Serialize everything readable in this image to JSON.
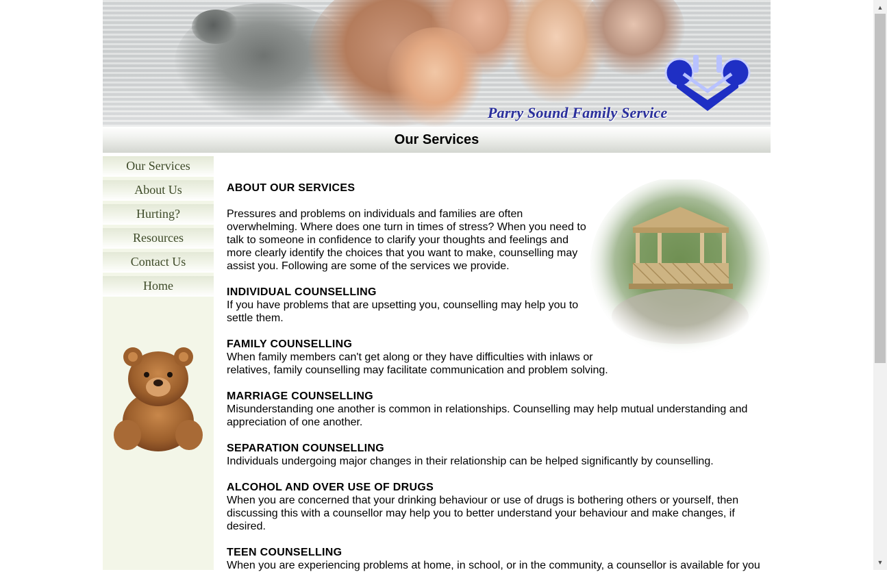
{
  "header": {
    "brand": "Parry Sound Family Service",
    "page_title": "Our Services"
  },
  "sidebar": {
    "items": [
      {
        "label": "Our Services"
      },
      {
        "label": "About Us"
      },
      {
        "label": "Hurting?"
      },
      {
        "label": "Resources"
      },
      {
        "label": "Contact Us"
      },
      {
        "label": "Home"
      }
    ]
  },
  "content": {
    "heading": "ABOUT OUR SERVICES",
    "intro": "Pressures and problems on individuals and families are often overwhelming. Where does one turn in times of stress? When you need to talk to someone in confidence to clarify your thoughts and feelings and more clearly identify the choices that you want to make, counselling may assist you. Following are some of the services we provide.",
    "sections": [
      {
        "title": "INDIVIDUAL COUNSELLING",
        "text": "If you have problems that are upsetting you, counselling may help you to settle them."
      },
      {
        "title": "FAMILY COUNSELLING",
        "text": "When family members can't get along or they have difficulties with inlaws or relatives, family counselling may facilitate communication and problem solving."
      },
      {
        "title": "MARRIAGE COUNSELLING",
        "text": "Misunderstanding one another is common in relationships. Counselling may help mutual understanding and appreciation of one another."
      },
      {
        "title": "SEPARATION COUNSELLING",
        "text": "Individuals undergoing major changes in their relationship can be helped significantly by counselling."
      },
      {
        "title": "ALCOHOL AND OVER USE OF DRUGS",
        "text": "When you are concerned that your drinking behaviour or use of drugs is bothering others or yourself, then discussing this with a counsellor may help you to better understand your behaviour and make changes, if desired."
      },
      {
        "title": "TEEN COUNSELLING",
        "text": "When you are experiencing problems at home, in school, or in the community, a counsellor is available for you"
      }
    ]
  },
  "colors": {
    "brand_text": "#2a2f9c",
    "logo_blue": "#1f2fc4",
    "sidebar_bg": "#f3f6e8",
    "nav_text": "#3d4a28"
  },
  "icons": {
    "scroll_up": "scroll-up-arrow-icon",
    "scroll_down": "scroll-down-arrow-icon"
  }
}
